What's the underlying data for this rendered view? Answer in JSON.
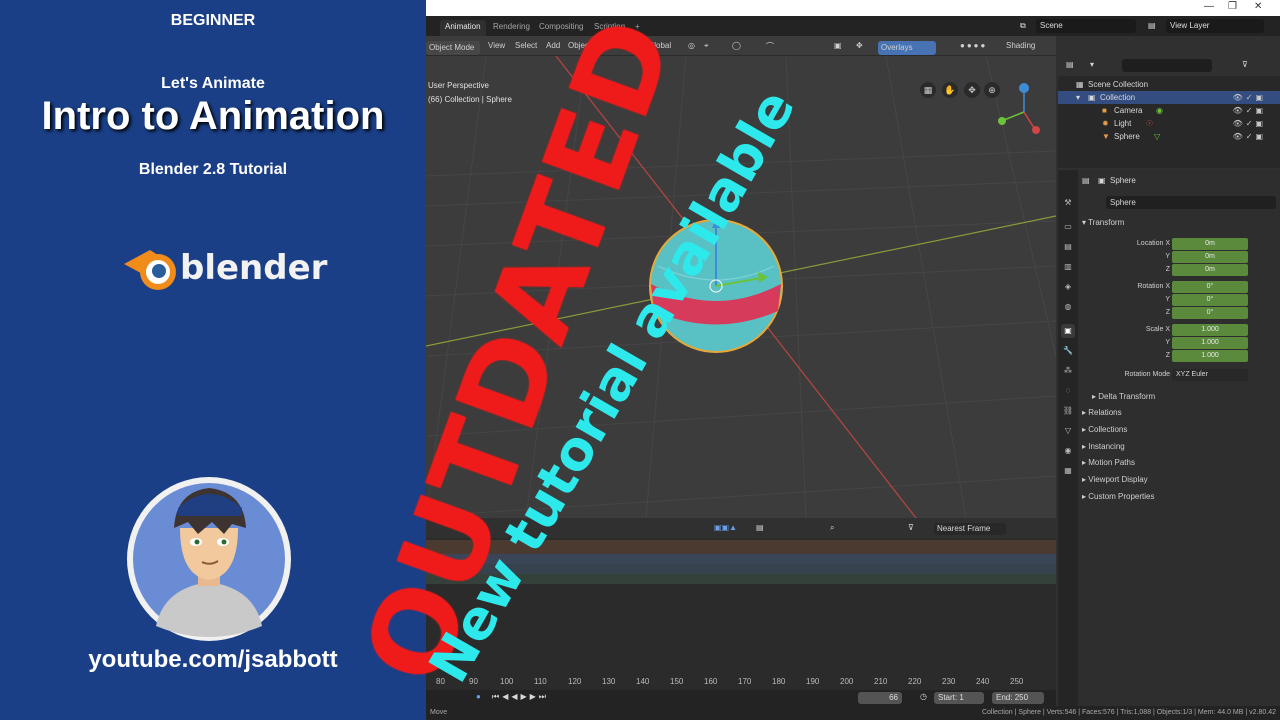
{
  "banner": {
    "level": "BEGINNER",
    "series": "Let's Animate",
    "title": "Intro to Animation",
    "subtitle": "Blender 2.8 Tutorial",
    "logo_text": "blender",
    "url": "youtube.com/jsabbott",
    "bg_color": "#1a3f87"
  },
  "overlay": {
    "stamp": "OUTDATED",
    "stamp_color": "#ef1a1a",
    "notice": "New tutorial available",
    "notice_color": "#2ee9ec"
  },
  "workspace_tabs": [
    "Animation",
    "Rendering",
    "Compositing",
    "Scripting"
  ],
  "active_tab": "Animation",
  "window_controls": [
    "—",
    "❐",
    "✕"
  ],
  "scene": "Scene",
  "view_layer": "View Layer",
  "viewport": {
    "mode": "Object Mode",
    "menus": [
      "View",
      "Select",
      "Add",
      "Object"
    ],
    "orientation": "Global",
    "overlays": "Overlays",
    "shading": "Shading",
    "perspective": "User Perspective",
    "context": "(66) Collection | Sphere"
  },
  "outliner": {
    "root": "Scene Collection",
    "collection": "Collection",
    "items": [
      "Camera",
      "Light",
      "Sphere"
    ]
  },
  "properties": {
    "object_name": "Sphere",
    "data_name": "Sphere",
    "transform_title": "Transform",
    "location": {
      "x": "0m",
      "y": "0m",
      "z": "0m"
    },
    "rotation": {
      "x": "0°",
      "y": "0°",
      "z": "0°"
    },
    "scale": {
      "x": "1.000",
      "y": "1.000",
      "z": "1.000"
    },
    "labels": {
      "location_x": "Location X",
      "y": "Y",
      "z": "Z",
      "rotation_x": "Rotation X",
      "scale_x": "Scale X",
      "rotation_mode": "Rotation Mode"
    },
    "rotation_mode": "XYZ Euler",
    "delta": "Delta Transform",
    "panels": [
      "Relations",
      "Collections",
      "Instancing",
      "Motion Paths",
      "Viewport Display",
      "Custom Properties"
    ]
  },
  "timeline": {
    "snap": "Nearest Frame",
    "ticks": [
      "80",
      "90",
      "100",
      "110",
      "120",
      "130",
      "140",
      "150",
      "160",
      "170",
      "180",
      "190",
      "200",
      "210",
      "220",
      "230",
      "240",
      "250"
    ],
    "current_frame": "66",
    "start_label": "Start:",
    "start": "1",
    "end_label": "End:",
    "end": "250"
  },
  "status": {
    "left": "Move",
    "right": "Collection | Sphere | Verts:546 | Faces:576 | Tris:1,088 | Objects:1/3 | Mem: 44.0 MB | v2.80.42"
  }
}
